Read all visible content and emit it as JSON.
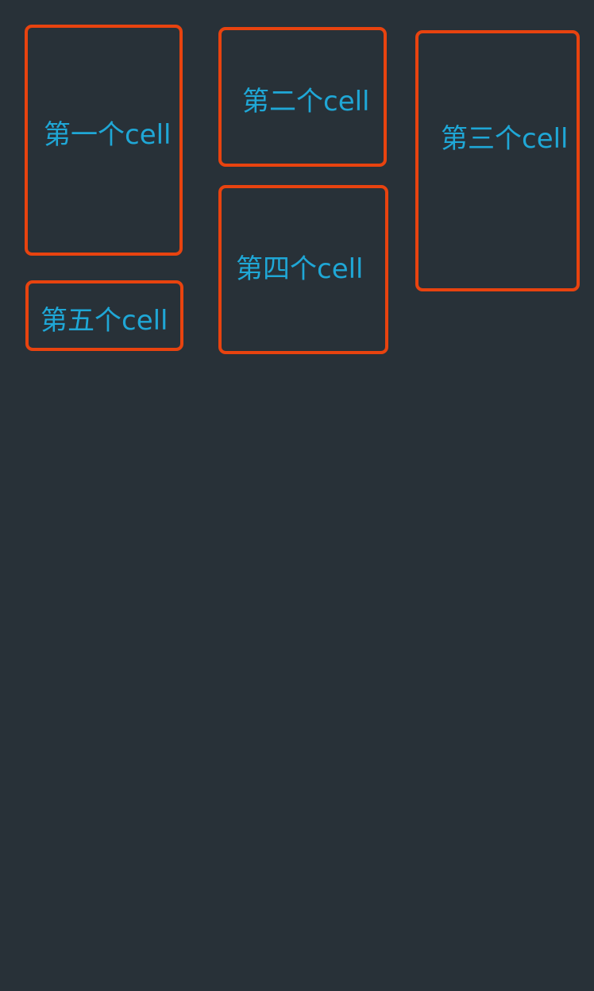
{
  "collection": {
    "cells": [
      {
        "label": "第一个cell"
      },
      {
        "label": "第二个cell"
      },
      {
        "label": "第三个cell"
      },
      {
        "label": "第四个cell"
      },
      {
        "label": "第五个cell"
      }
    ]
  },
  "colors": {
    "background": "#283138",
    "cell_border": "#e8430f",
    "cell_text": "#1fa7d6"
  }
}
